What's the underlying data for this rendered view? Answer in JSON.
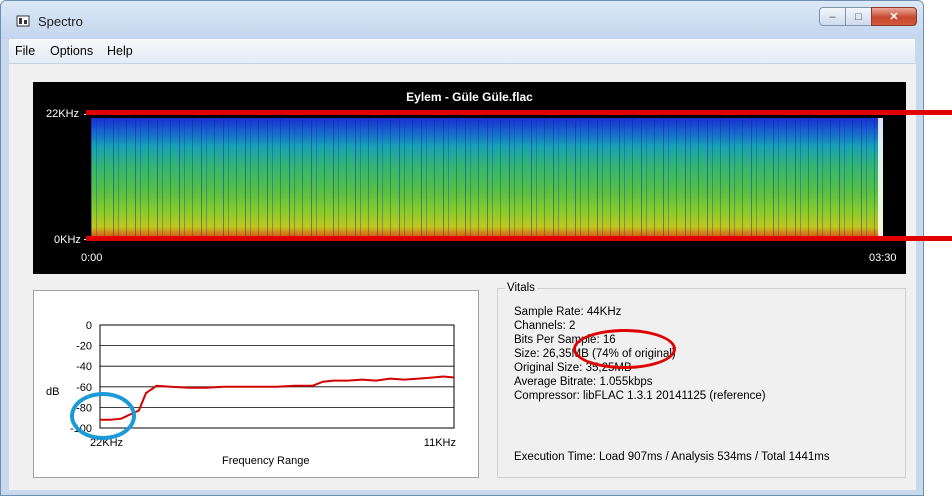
{
  "window": {
    "title": "Spectro",
    "app_icon": "spectro-app-icon"
  },
  "menu": [
    "File",
    "Options",
    "Help"
  ],
  "spectrogram": {
    "title": "Eylem - Güle Güle.flac",
    "freq_top": "22KHz",
    "freq_bottom": "0KHz",
    "time_start": "0:00",
    "time_end": "03:30",
    "colors": {
      "annotation_red": "#e00000",
      "annotation_blue": "#1b9ad6"
    }
  },
  "graph": {
    "y_axis_label": "dB",
    "x_axis_title": "Frequency Range",
    "x_left": "22KHz",
    "x_right": "11KHz"
  },
  "chart_data": {
    "type": "line",
    "xlabel": "Frequency Range",
    "ylabel": "dB",
    "ylim": [
      -100,
      0
    ],
    "yticks": [
      "0",
      "-20",
      "-40",
      "-60",
      "-80",
      "-100"
    ],
    "x_tick_labels": [
      "22KHz",
      "11KHz"
    ],
    "grid": true,
    "series": [
      {
        "color": "#d40000",
        "x": [
          0,
          0.03,
          0.06,
          0.09,
          0.11,
          0.13,
          0.16,
          0.2,
          0.25,
          0.3,
          0.35,
          0.4,
          0.45,
          0.5,
          0.55,
          0.6,
          0.63,
          0.66,
          0.7,
          0.74,
          0.78,
          0.82,
          0.86,
          0.9,
          0.94,
          0.97,
          1.0
        ],
        "y": [
          -92,
          -92,
          -91,
          -86,
          -83,
          -66,
          -59,
          -60,
          -61,
          -61,
          -60,
          -60,
          -60,
          -60,
          -59,
          -59,
          -55,
          -54,
          -54,
          -53,
          -54,
          -52,
          -53,
          -52,
          -51,
          -50,
          -51
        ]
      }
    ]
  },
  "vitals": {
    "legend": "Vitals",
    "lines": [
      "Sample Rate: 44KHz",
      "Channels: 2",
      "Bits Per Sample: 16",
      "Size: 26,35MB (74% of original)",
      "Original Size: 35,25MB",
      "Average Bitrate: 1.055kbps",
      "Compressor: libFLAC 1.3.1 20141125 (reference)"
    ],
    "execution": "Execution Time: Load 907ms / Analysis 534ms / Total 1441ms"
  }
}
